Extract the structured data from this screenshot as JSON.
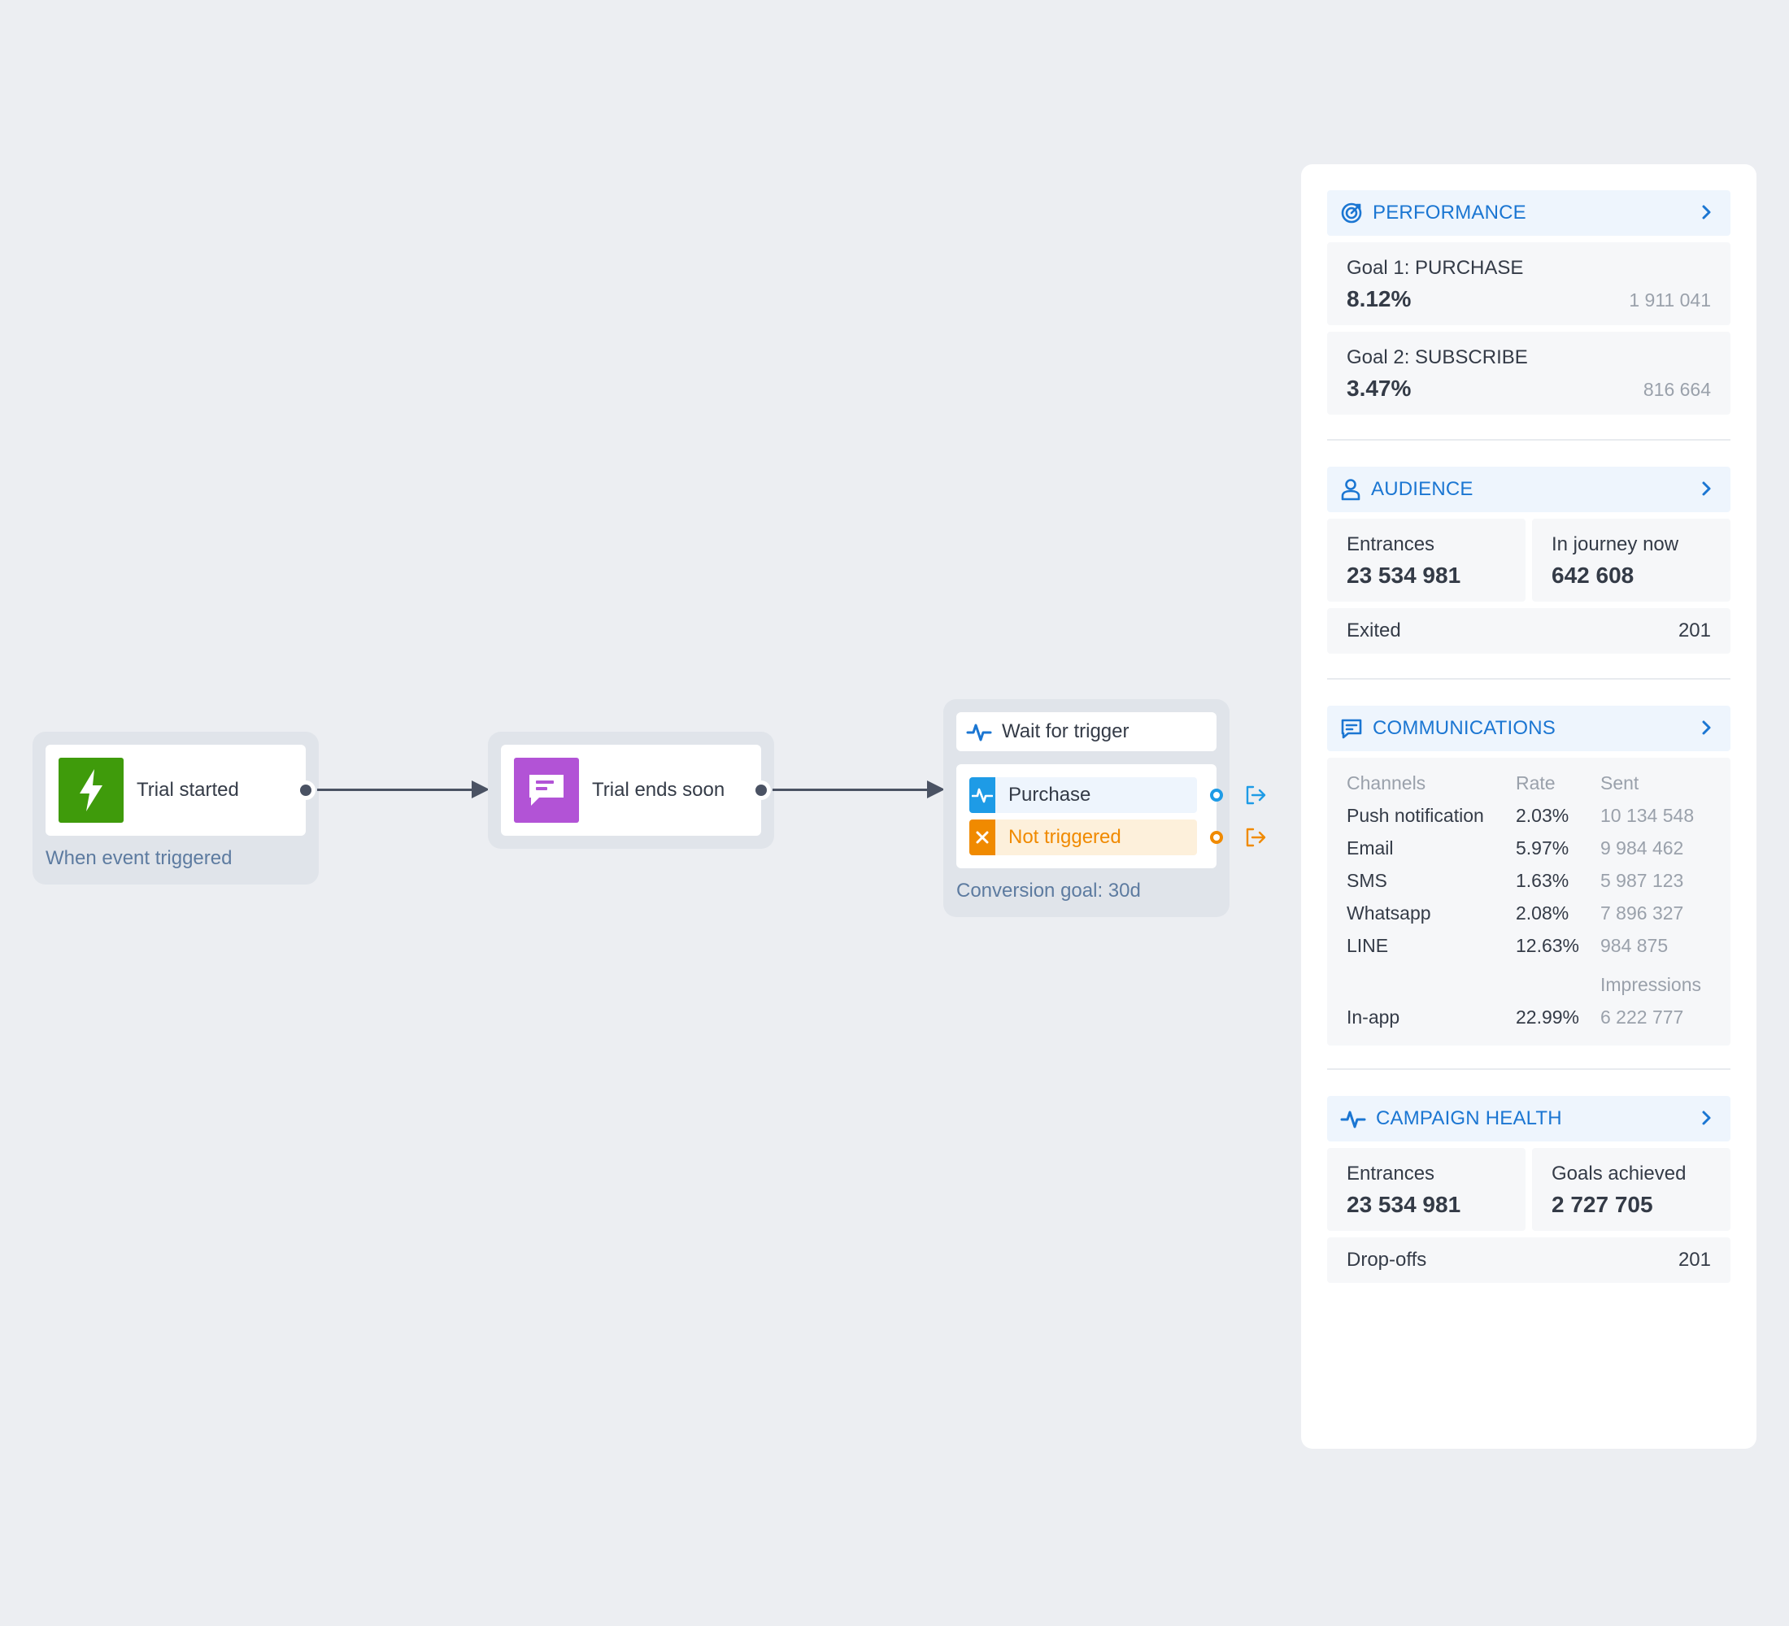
{
  "flow": {
    "node1": {
      "title": "Trial started",
      "subtitle": "When event triggered",
      "icon": "lightning-bolt-icon",
      "color": "#3f9b0b"
    },
    "node2": {
      "title": "Trial ends soon",
      "icon": "message-icon",
      "color": "#b253d6"
    },
    "node3": {
      "title": "Wait for trigger",
      "icon": "activity-icon",
      "branches": [
        {
          "label": "Purchase",
          "icon": "activity-icon",
          "color": "#1e9be6"
        },
        {
          "label": "Not triggered",
          "icon": "x-icon",
          "color": "#f08a00"
        }
      ],
      "subtitle": "Conversion goal: 30d"
    }
  },
  "panel": {
    "performance": {
      "title": "PERFORMANCE",
      "goals": [
        {
          "label": "Goal 1: PURCHASE",
          "rate": "8.12%",
          "count": "1 911 041"
        },
        {
          "label": "Goal 2: SUBSCRIBE",
          "rate": "3.47%",
          "count": "816 664"
        }
      ]
    },
    "audience": {
      "title": "AUDIENCE",
      "entrances_label": "Entrances",
      "entrances_value": "23 534 981",
      "journey_label": "In journey now",
      "journey_value": "642 608",
      "exited_label": "Exited",
      "exited_value": "201"
    },
    "communications": {
      "title": "COMMUNICATIONS",
      "headers": {
        "channels": "Channels",
        "rate": "Rate",
        "sent": "Sent"
      },
      "rows": [
        {
          "channel": "Push notification",
          "rate": "2.03%",
          "sent": "10 134 548"
        },
        {
          "channel": "Email",
          "rate": "5.97%",
          "sent": "9 984 462"
        },
        {
          "channel": "SMS",
          "rate": "1.63%",
          "sent": "5 987 123"
        },
        {
          "channel": "Whatsapp",
          "rate": "2.08%",
          "sent": "7 896 327"
        },
        {
          "channel": "LINE",
          "rate": "12.63%",
          "sent": "984 875"
        }
      ],
      "impressions_header": "Impressions",
      "inapp": {
        "channel": "In-app",
        "rate": "22.99%",
        "sent": "6 222 777"
      }
    },
    "campaign_health": {
      "title": "CAMPAIGN HEALTH",
      "entrances_label": "Entrances",
      "entrances_value": "23 534 981",
      "goals_label": "Goals achieved",
      "goals_value": "2 727 705",
      "dropoffs_label": "Drop-offs",
      "dropoffs_value": "201"
    }
  },
  "colors": {
    "accent": "#1b76d2",
    "canvas": "#eceef2",
    "connector": "#4a5263",
    "success": "#3f9b0b",
    "message": "#b253d6",
    "purchase": "#1e9be6",
    "not_triggered": "#f08a00"
  }
}
